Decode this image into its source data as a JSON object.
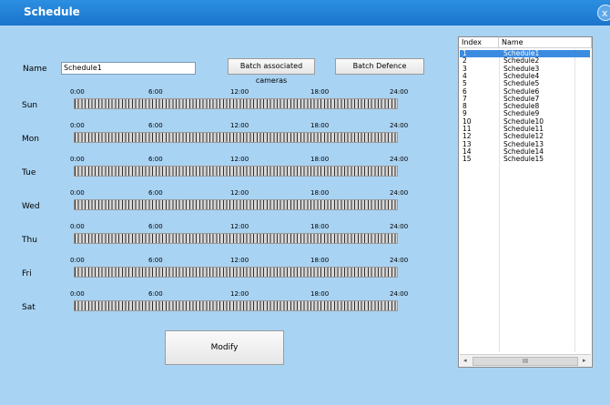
{
  "window": {
    "title": "Schedule",
    "close_symbol": "x"
  },
  "form": {
    "name_label": "Name",
    "name_value": "Schedule1"
  },
  "buttons": {
    "batch_cameras": "Batch associated cameras",
    "batch_defence": "Batch Defence",
    "modify": "Modify"
  },
  "ticks": [
    "0:00",
    "6:00",
    "12:00",
    "18:00",
    "24:00"
  ],
  "days": [
    "Sun",
    "Mon",
    "Tue",
    "Wed",
    "Thu",
    "Fri",
    "Sat"
  ],
  "list": {
    "headers": {
      "index": "Index",
      "name": "Name"
    },
    "rows": [
      {
        "index": "1",
        "name": "Schedule1"
      },
      {
        "index": "2",
        "name": "Schedule2"
      },
      {
        "index": "3",
        "name": "Schedule3"
      },
      {
        "index": "4",
        "name": "Schedule4"
      },
      {
        "index": "5",
        "name": "Schedule5"
      },
      {
        "index": "6",
        "name": "Schedule6"
      },
      {
        "index": "7",
        "name": "Schedule7"
      },
      {
        "index": "8",
        "name": "Schedule8"
      },
      {
        "index": "9",
        "name": "Schedule9"
      },
      {
        "index": "10",
        "name": "Schedule10"
      },
      {
        "index": "11",
        "name": "Schedule11"
      },
      {
        "index": "12",
        "name": "Schedule12"
      },
      {
        "index": "13",
        "name": "Schedule13"
      },
      {
        "index": "14",
        "name": "Schedule14"
      },
      {
        "index": "15",
        "name": "Schedule15"
      }
    ],
    "selected_index": "1",
    "scroll": {
      "left": "◂",
      "right": "▸",
      "thumb": "III"
    }
  }
}
